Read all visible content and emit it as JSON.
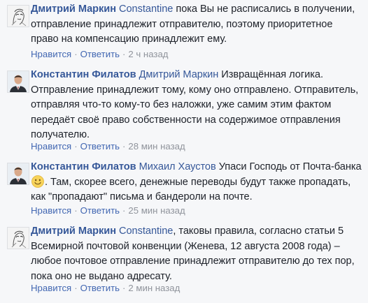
{
  "comments": [
    {
      "author": "Дмитрий Маркин",
      "mention": "Constantine",
      "text": " пока Вы не расписались в получении, отправление принадлежит отправителю, поэтому приоритетное право на компенсацию принадлежит ему.",
      "like": "Нравится",
      "reply": "Ответить",
      "time": "2 ч назад",
      "avatar": "sketch-portrait-avatar"
    },
    {
      "author": "Константин Филатов",
      "mention": "Дмитрий Маркин",
      "text": " Извращённая логика. Отправление принадлежит тому, кому оно отправлено. Отправитель, отправляя что-то кому-то без наложки, уже самим этим фактом передаёт своё право собственности на содержимое отправления получателю.",
      "like": "Нравится",
      "reply": "Ответить",
      "time": "28 мин назад",
      "avatar": "man-in-suit-avatar"
    },
    {
      "author": "Константин Филатов",
      "mention": "Михаил Хаустов",
      "text_before": " Упаси Господь от Почта-банка ",
      "emoji": "smiley-emoji",
      "text_after": ". Там, скорее всего, денежные переводы будут также пропадать, как \"пропадают\" письма и бандероли на почте.",
      "like": "Нравится",
      "reply": "Ответить",
      "time": "25 мин назад",
      "avatar": "man-in-suit-avatar"
    },
    {
      "author": "Дмитрий Маркин",
      "mention": "Constantine",
      "text": ", таковы правила, согласно статьи 5 Всемирной почтовой конвенции (Женева, 12 августа 2008 года) – любое почтовое отправление принадлежит отправителю до тех пор, пока оно не выдано адресату.",
      "like": "Нравится",
      "reply": "Ответить",
      "time": "2 мин назад",
      "avatar": "sketch-portrait-avatar"
    }
  ],
  "separator": "·",
  "colors": {
    "link": "#365899",
    "action_link": "#4267b2",
    "meta": "#90949c",
    "background": "#f6f7f9"
  }
}
